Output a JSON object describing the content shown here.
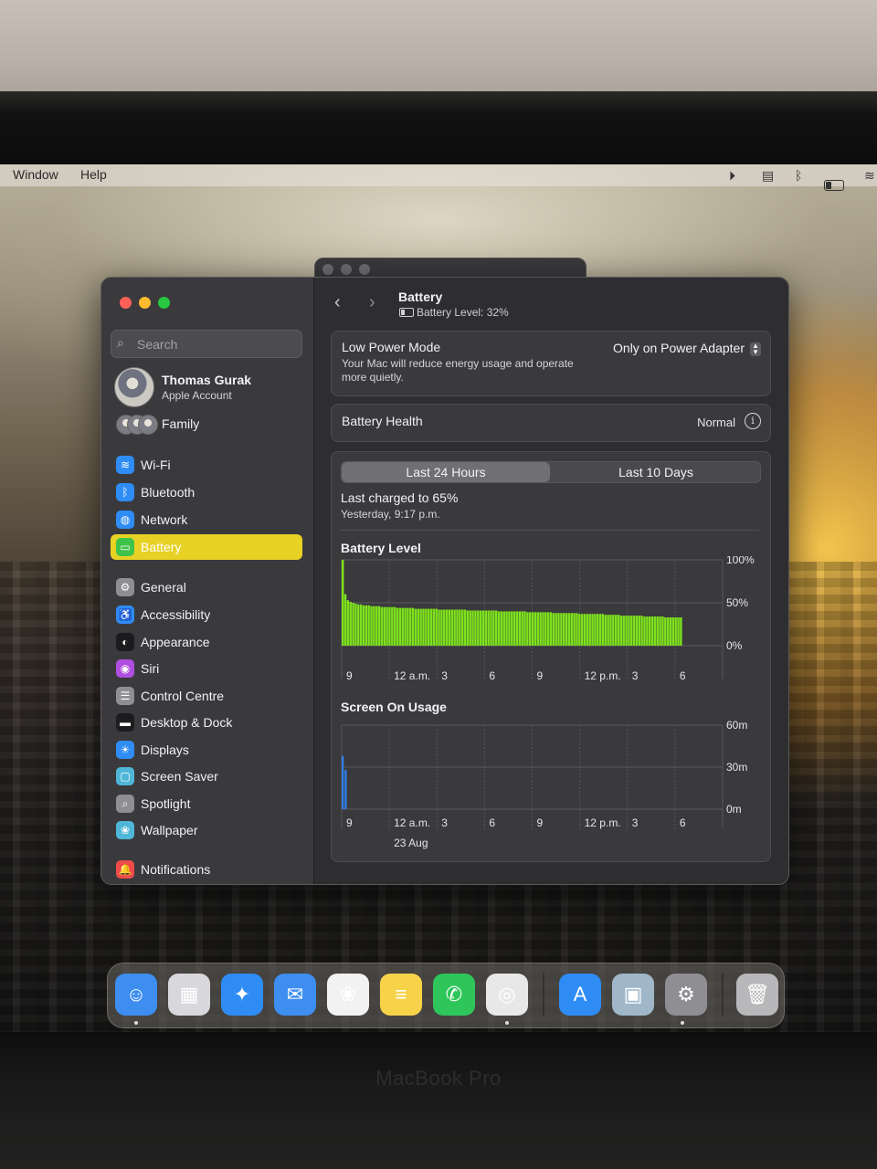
{
  "menubar": {
    "items": [
      "Window",
      "Help"
    ]
  },
  "window_title": "Battery",
  "battery_level_text": "Battery Level: 32%",
  "sidebar": {
    "search_placeholder": "Search",
    "account": {
      "name": "Thomas Gurak",
      "subtitle": "Apple Account"
    },
    "family_label": "Family",
    "items": [
      {
        "label": "Wi-Fi",
        "icon": "wifi-icon",
        "color": "#2f8cf5",
        "glyph": "≋"
      },
      {
        "label": "Bluetooth",
        "icon": "bluetooth-icon",
        "color": "#2f8cf5",
        "glyph": "ᛒ"
      },
      {
        "label": "Network",
        "icon": "globe-icon",
        "color": "#2f8cf5",
        "glyph": "◍"
      },
      {
        "label": "Battery",
        "icon": "battery-icon",
        "color": "#3fc24a",
        "glyph": "▭",
        "active": true
      },
      {
        "label": "General",
        "icon": "gear-icon",
        "color": "#8e8e93",
        "glyph": "⚙"
      },
      {
        "label": "Accessibility",
        "icon": "accessibility-icon",
        "color": "#2f8cf5",
        "glyph": "♿"
      },
      {
        "label": "Appearance",
        "icon": "appearance-icon",
        "color": "#1c1c1e",
        "glyph": "◐"
      },
      {
        "label": "Siri",
        "icon": "siri-icon",
        "color": "#b04ee0",
        "glyph": "◉"
      },
      {
        "label": "Control Centre",
        "icon": "control-centre-icon",
        "color": "#8e8e93",
        "glyph": "☰"
      },
      {
        "label": "Desktop & Dock",
        "icon": "dock-icon",
        "color": "#1c1c1e",
        "glyph": "▬"
      },
      {
        "label": "Displays",
        "icon": "displays-icon",
        "color": "#2f8cf5",
        "glyph": "☀"
      },
      {
        "label": "Screen Saver",
        "icon": "screen-saver-icon",
        "color": "#4fb6d8",
        "glyph": "▢"
      },
      {
        "label": "Spotlight",
        "icon": "spotlight-icon",
        "color": "#8e8e93",
        "glyph": "⌕"
      },
      {
        "label": "Wallpaper",
        "icon": "wallpaper-icon",
        "color": "#4fb6d8",
        "glyph": "❀"
      },
      {
        "label": "Notifications",
        "icon": "bell-icon",
        "color": "#ef4b4b",
        "glyph": "🔔"
      }
    ]
  },
  "low_power_mode": {
    "title": "Low Power Mode",
    "description": "Your Mac will reduce energy usage and operate more quietly.",
    "value": "Only on Power Adapter"
  },
  "battery_health": {
    "label": "Battery Health",
    "value": "Normal"
  },
  "range_tabs": [
    "Last 24 Hours",
    "Last 10 Days"
  ],
  "selected_tab": "Last 24 Hours",
  "last_charged": {
    "title": "Last charged to 65%",
    "subtitle": "Yesterday, 9:17 p.m."
  },
  "colors": {
    "accent": "#e8d125",
    "battery_bar": "#7ee21c",
    "usage_bar": "#2f7ff0"
  },
  "chart_data": [
    {
      "type": "bar",
      "title": "Battery Level",
      "ylim": [
        0,
        100
      ],
      "y_ticks": [
        "100%",
        "50%",
        "0%"
      ],
      "x_tick_labels": [
        "9",
        "12 a.m.",
        "3",
        "6",
        "9",
        "12 p.m.",
        "3",
        "6"
      ],
      "values": [
        100,
        60,
        53,
        51,
        50,
        49,
        48,
        48,
        47,
        47,
        47,
        46,
        46,
        46,
        46,
        45,
        45,
        45,
        45,
        45,
        45,
        44,
        44,
        44,
        44,
        44,
        44,
        44,
        43,
        43,
        43,
        43,
        43,
        43,
        43,
        43,
        43,
        42,
        42,
        42,
        42,
        42,
        42,
        42,
        42,
        42,
        42,
        42,
        41,
        41,
        41,
        41,
        41,
        41,
        41,
        41,
        41,
        41,
        41,
        41,
        40,
        40,
        40,
        40,
        40,
        40,
        40,
        40,
        40,
        40,
        40,
        39,
        39,
        39,
        39,
        39,
        39,
        39,
        39,
        39,
        39,
        38,
        38,
        38,
        38,
        38,
        38,
        38,
        38,
        38,
        38,
        37,
        37,
        37,
        37,
        37,
        37,
        37,
        37,
        37,
        37,
        36,
        36,
        36,
        36,
        36,
        36,
        35,
        35,
        35,
        35,
        35,
        35,
        35,
        35,
        35,
        34,
        34,
        34,
        34,
        34,
        34,
        34,
        34,
        33,
        33,
        33,
        33,
        33,
        33,
        33
      ]
    },
    {
      "type": "bar",
      "title": "Screen On Usage",
      "ylim": [
        0,
        60
      ],
      "y_ticks": [
        "60m",
        "30m",
        "0m"
      ],
      "x_tick_labels": [
        "9",
        "12 a.m.",
        "3",
        "6",
        "9",
        "12 p.m.",
        "3",
        "6"
      ],
      "x_sub_label": "23 Aug",
      "values": [
        38,
        28,
        0,
        0,
        0,
        0,
        0,
        0,
        0,
        0,
        0,
        0,
        0,
        0,
        0,
        0,
        0,
        0,
        0,
        0,
        0,
        0,
        0,
        0,
        0,
        0,
        0,
        0,
        0,
        0,
        0,
        0
      ]
    }
  ],
  "dock": [
    {
      "name": "finder",
      "icon": "finder-icon",
      "color": "#3d8ef0",
      "glyph": "☺"
    },
    {
      "name": "launchpad",
      "icon": "launchpad-icon",
      "color": "#d8d8dc",
      "glyph": "▦"
    },
    {
      "name": "safari",
      "icon": "safari-icon",
      "color": "#2f8cf5",
      "glyph": "✦"
    },
    {
      "name": "mail",
      "icon": "mail-icon",
      "color": "#3d8ef0",
      "glyph": "✉"
    },
    {
      "name": "photos",
      "icon": "photos-icon",
      "color": "#f2f2f2",
      "glyph": "❀"
    },
    {
      "name": "notes",
      "icon": "notes-icon",
      "color": "#f7d34a",
      "glyph": "≡"
    },
    {
      "name": "whatsapp",
      "icon": "whatsapp-icon",
      "color": "#2ec65a",
      "glyph": "✆"
    },
    {
      "name": "chrome",
      "icon": "chrome-icon",
      "color": "#e8e8e8",
      "glyph": "◎"
    },
    {
      "name": "app-store",
      "icon": "app-store-icon",
      "color": "#2f8cf5",
      "glyph": "A"
    },
    {
      "name": "preview",
      "icon": "preview-icon",
      "color": "#9fb7c9",
      "glyph": "▣"
    },
    {
      "name": "system-settings",
      "icon": "system-settings-icon",
      "color": "#8e8e93",
      "glyph": "⚙"
    },
    {
      "name": "trash",
      "icon": "trash-icon",
      "color": "#b8b8bb",
      "glyph": "🗑"
    }
  ],
  "hardware_label": "MacBook Pro"
}
